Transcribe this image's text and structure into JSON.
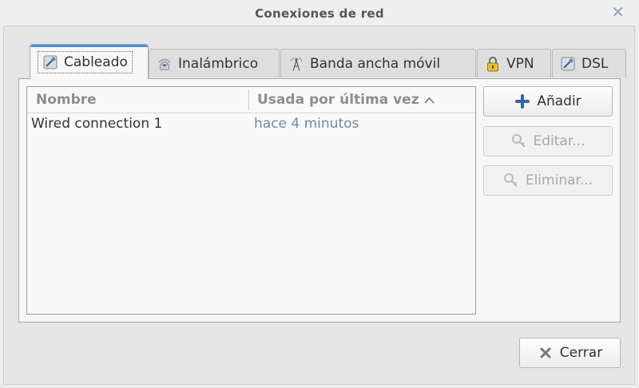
{
  "window": {
    "title": "Conexiones de red"
  },
  "tabs": [
    {
      "label": "Cableado",
      "icon": "wired-icon",
      "active": true
    },
    {
      "label": "Inalámbrico",
      "icon": "wireless-icon",
      "active": false
    },
    {
      "label": "Banda ancha móvil",
      "icon": "antenna-icon",
      "active": false
    },
    {
      "label": "VPN",
      "icon": "lock-icon",
      "active": false
    },
    {
      "label": "DSL",
      "icon": "dsl-icon",
      "active": false
    }
  ],
  "list": {
    "columns": {
      "name": "Nombre",
      "last_used": "Usada por última vez"
    },
    "sort_indicator": "^",
    "rows": [
      {
        "name": "Wired connection 1",
        "last_used": "hace 4 minutos"
      }
    ]
  },
  "buttons": {
    "add": "Añadir",
    "edit": "Editar...",
    "delete": "Eliminar...",
    "close": "Cerrar"
  },
  "colors": {
    "accent": "#4a90d9",
    "timestamp": "#6f8aa3",
    "disabled_text": "#a6a9aa"
  }
}
